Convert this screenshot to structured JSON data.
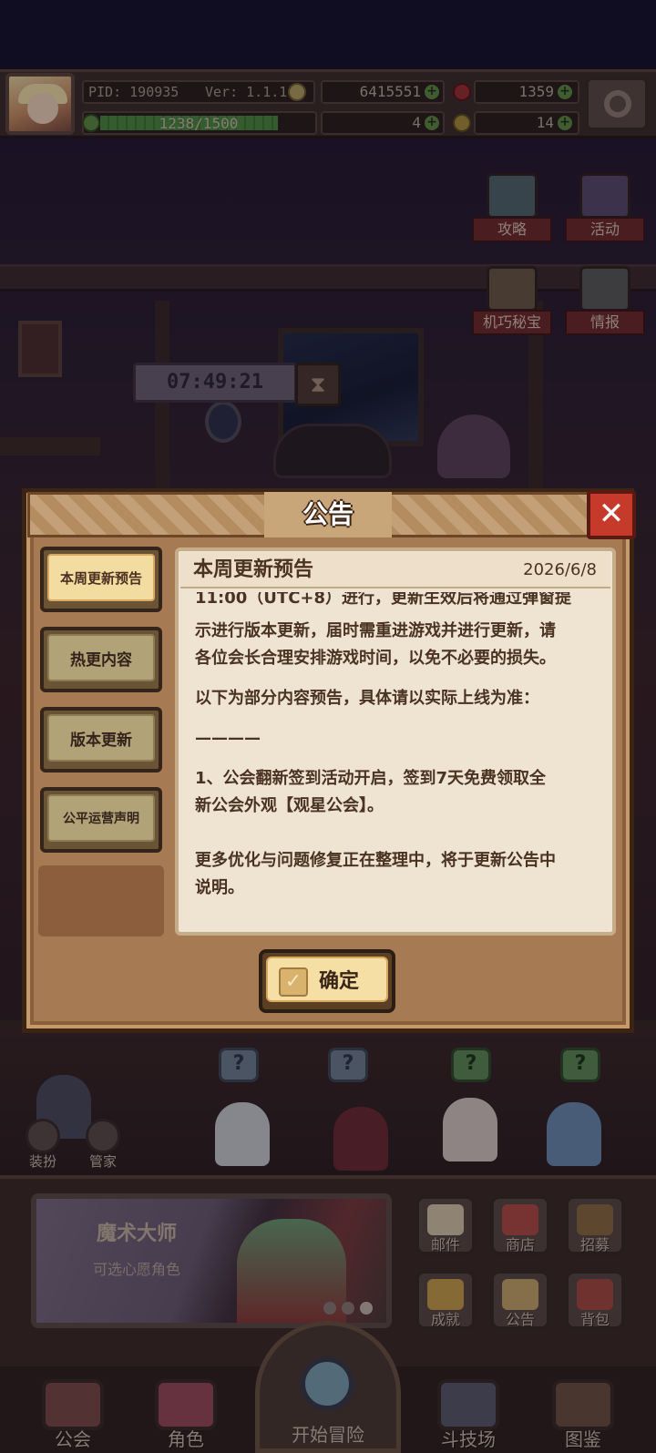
{
  "topbar": {
    "pid": "PID: 190935",
    "version": "Ver: 1.1.1.4",
    "gold": "6415551",
    "gems": "1359",
    "clover": "4",
    "notes": "14",
    "xp": "1238/1500",
    "xp_fraction": 0.825
  },
  "side_buttons": {
    "strategy": "攻略",
    "events": "活动",
    "treasure": "机巧秘宝",
    "intel": "情报"
  },
  "timer": "07:49:21",
  "modal": {
    "title": "公告",
    "tabs": [
      {
        "label": "本周更新预告",
        "active": true
      },
      {
        "label": "热更内容",
        "active": false
      },
      {
        "label": "版本更新",
        "active": false
      },
      {
        "label": "公平运营声明",
        "active": false
      }
    ],
    "content": {
      "title": "本周更新预告",
      "date": "2026/6/8",
      "partial_first_line": "11:00（UTC+8）进行，更新生效后将通过弹窗提",
      "paragraphs": [
        "示进行版本更新，届时需重进游戏并进行更新，请",
        "各位会长合理安排游戏时间，以免不必要的损失。",
        "以下为部分内容预告，具体请以实际上线为准：",
        "————",
        "1、公会翻新签到活动开启，签到7天免费领取全",
        "新公会外观【观星公会】。",
        "更多优化与问题修复正在整理中，将于更新公告中",
        "说明。"
      ]
    },
    "confirm_label": "确定"
  },
  "scene_icons": {
    "dress_up": "装扮",
    "butler": "管家"
  },
  "banner": {
    "title": "魔术大师",
    "subtitle": "可选心愿角色"
  },
  "grid_buttons": {
    "mail": "邮件",
    "shop": "商店",
    "recruit": "招募",
    "achievements": "成就",
    "notice": "公告",
    "backpack": "背包"
  },
  "nav": {
    "guild": "公会",
    "character": "角色",
    "adventure": "开始冒险",
    "arena": "斗技场",
    "codex": "图鉴"
  }
}
